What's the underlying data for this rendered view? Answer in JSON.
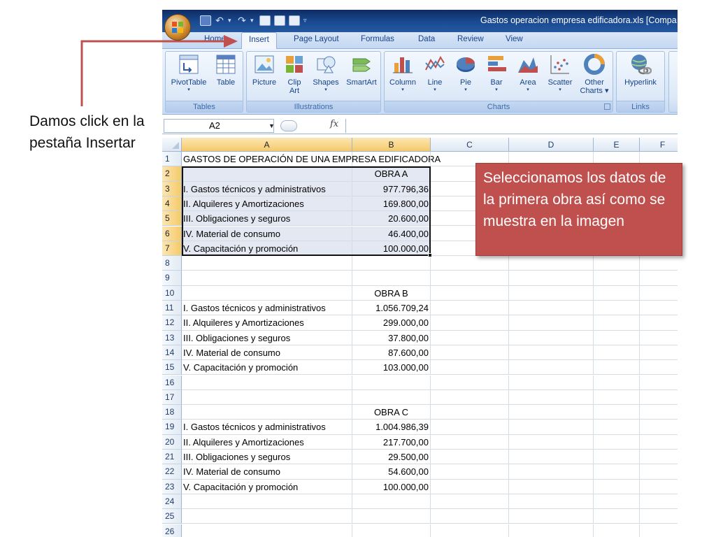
{
  "annotations": {
    "left_note": "Damos click en la pestaña Insertar",
    "callout": "Seleccionamos los datos de la primera obra así como se muestra en la imagen",
    "arrow_color": "#c0504d"
  },
  "window": {
    "title": "Gastos operacion empresa edificadora.xls  [Compa"
  },
  "tabs": [
    {
      "label": "Home",
      "active": false
    },
    {
      "label": "Insert",
      "active": true
    },
    {
      "label": "Page Layout",
      "active": false
    },
    {
      "label": "Formulas",
      "active": false
    },
    {
      "label": "Data",
      "active": false
    },
    {
      "label": "Review",
      "active": false
    },
    {
      "label": "View",
      "active": false
    }
  ],
  "ribbon": {
    "groups": [
      {
        "label": "Tables",
        "buttons": [
          {
            "label": "PivotTable",
            "icon": "pivot-table-icon",
            "dropdown": true
          },
          {
            "label": "Table",
            "icon": "table-icon",
            "dropdown": false
          }
        ]
      },
      {
        "label": "Illustrations",
        "buttons": [
          {
            "label": "Picture",
            "icon": "picture-icon",
            "dropdown": false
          },
          {
            "label": "Clip Art",
            "icon": "clip-art-icon",
            "dropdown": false
          },
          {
            "label": "Shapes",
            "icon": "shapes-icon",
            "dropdown": true
          },
          {
            "label": "SmartArt",
            "icon": "smartart-icon",
            "dropdown": false
          }
        ]
      },
      {
        "label": "Charts",
        "buttons": [
          {
            "label": "Column",
            "icon": "column-chart-icon",
            "dropdown": true
          },
          {
            "label": "Line",
            "icon": "line-chart-icon",
            "dropdown": true
          },
          {
            "label": "Pie",
            "icon": "pie-chart-icon",
            "dropdown": true
          },
          {
            "label": "Bar",
            "icon": "bar-chart-icon",
            "dropdown": true
          },
          {
            "label": "Area",
            "icon": "area-chart-icon",
            "dropdown": true
          },
          {
            "label": "Scatter",
            "icon": "scatter-chart-icon",
            "dropdown": true
          },
          {
            "label": "Other Charts",
            "icon": "other-charts-icon",
            "dropdown": true
          }
        ]
      },
      {
        "label": "Links",
        "buttons": [
          {
            "label": "Hyperlink",
            "icon": "hyperlink-icon",
            "dropdown": false
          }
        ]
      }
    ]
  },
  "formula_bar": {
    "name_box": "A2",
    "fx_label": "fx",
    "content": ""
  },
  "sheet": {
    "columns": [
      "A",
      "B",
      "C",
      "D",
      "E",
      "F"
    ],
    "selected_columns": [
      "A",
      "B"
    ],
    "selected_rows": [
      2,
      3,
      4,
      5,
      6,
      7
    ],
    "rows": [
      {
        "n": "1",
        "a": "GASTOS DE OPERACIÓN DE UNA EMPRESA EDIFICADORA",
        "b": ""
      },
      {
        "n": "2",
        "a": "",
        "b": "OBRA A"
      },
      {
        "n": "3",
        "a": "I. Gastos técnicos y administrativos",
        "b": "977.796,36"
      },
      {
        "n": "4",
        "a": "II. Alquileres y Amortizaciones",
        "b": "169.800,00"
      },
      {
        "n": "5",
        "a": "III. Obligaciones y seguros",
        "b": "20.600,00"
      },
      {
        "n": "6",
        "a": "IV. Material de consumo",
        "b": "46.400,00"
      },
      {
        "n": "7",
        "a": "V. Capacitación y promoción",
        "b": "100.000,00"
      },
      {
        "n": "8",
        "a": "",
        "b": ""
      },
      {
        "n": "9",
        "a": "",
        "b": ""
      },
      {
        "n": "10",
        "a": "",
        "b": "OBRA B"
      },
      {
        "n": "11",
        "a": "I. Gastos técnicos y administrativos",
        "b": "1.056.709,24"
      },
      {
        "n": "12",
        "a": "II. Alquileres y Amortizaciones",
        "b": "299.000,00"
      },
      {
        "n": "13",
        "a": "III. Obligaciones y seguros",
        "b": "37.800,00"
      },
      {
        "n": "14",
        "a": "IV. Material de consumo",
        "b": "87.600,00"
      },
      {
        "n": "15",
        "a": "V. Capacitación y promoción",
        "b": "103.000,00"
      },
      {
        "n": "16",
        "a": "",
        "b": ""
      },
      {
        "n": "17",
        "a": "",
        "b": ""
      },
      {
        "n": "18",
        "a": "",
        "b": "OBRA C"
      },
      {
        "n": "19",
        "a": "I. Gastos técnicos y administrativos",
        "b": "1.004.986,39"
      },
      {
        "n": "20",
        "a": "II. Alquileres y Amortizaciones",
        "b": "217.700,00"
      },
      {
        "n": "21",
        "a": "III. Obligaciones y seguros",
        "b": "29.500,00"
      },
      {
        "n": "22",
        "a": "IV. Material de consumo",
        "b": "54.600,00"
      },
      {
        "n": "23",
        "a": "V. Capacitación y promoción",
        "b": "100.000,00"
      },
      {
        "n": "24",
        "a": "",
        "b": ""
      },
      {
        "n": "25",
        "a": "",
        "b": ""
      },
      {
        "n": "26",
        "a": "",
        "b": ""
      }
    ]
  }
}
